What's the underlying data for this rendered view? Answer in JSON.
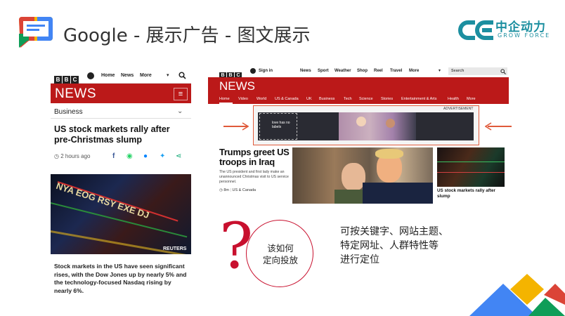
{
  "slide": {
    "title": "Google - 展示广告 - 图文展示",
    "brand_cn": "中企动力",
    "brand_en": "GROW FORCE",
    "accent": "#c8102e"
  },
  "mobile": {
    "bbc": [
      "B",
      "B",
      "C"
    ],
    "nav": [
      "Home",
      "News",
      "More"
    ],
    "news_label": "NEWS",
    "menu_icon": "≡",
    "section": "Business",
    "headline": "US stock markets rally after pre-Christmas slump",
    "time": "2 hours ago",
    "photo_credit": "REUTERS",
    "photo_tickers": "NYA  EOG  RSY  EXE  DJ",
    "body": "Stock markets in the US have seen significant rises, with the Dow Jones up by nearly 5% and the technology-focused Nasdaq rising by nearly 6%.",
    "brand_red": "#bb1919"
  },
  "desktop": {
    "bbc": [
      "B",
      "B",
      "C"
    ],
    "signin": "Sign in",
    "nav": [
      "News",
      "Sport",
      "Weather",
      "Shop",
      "Reel",
      "Travel",
      "More"
    ],
    "search_placeholder": "Search",
    "news_label": "NEWS",
    "subnav": [
      "Home",
      "Video",
      "World",
      "US & Canada",
      "UK",
      "Business",
      "Tech",
      "Science",
      "Stories",
      "Entertainment & Arts",
      "Health",
      "More"
    ],
    "ad_label": "ADVERTISEMENT",
    "ad_text": "love has no labels",
    "headline": "Trumps greet US troops in Iraq",
    "summary": "The US president and first lady make an unannounced Christmas visit to US service personnel.",
    "meta_time": "8m",
    "meta_section": "US & Canada",
    "side_caption": "US stock markets rally after slump"
  },
  "question": {
    "mark": "?",
    "text_line1": "该如何",
    "text_line2": "定向投放"
  },
  "targeting": {
    "line1": "可按关键字、网站主题、",
    "line2": "特定网址、人群特性等",
    "line3": "进行定位"
  }
}
